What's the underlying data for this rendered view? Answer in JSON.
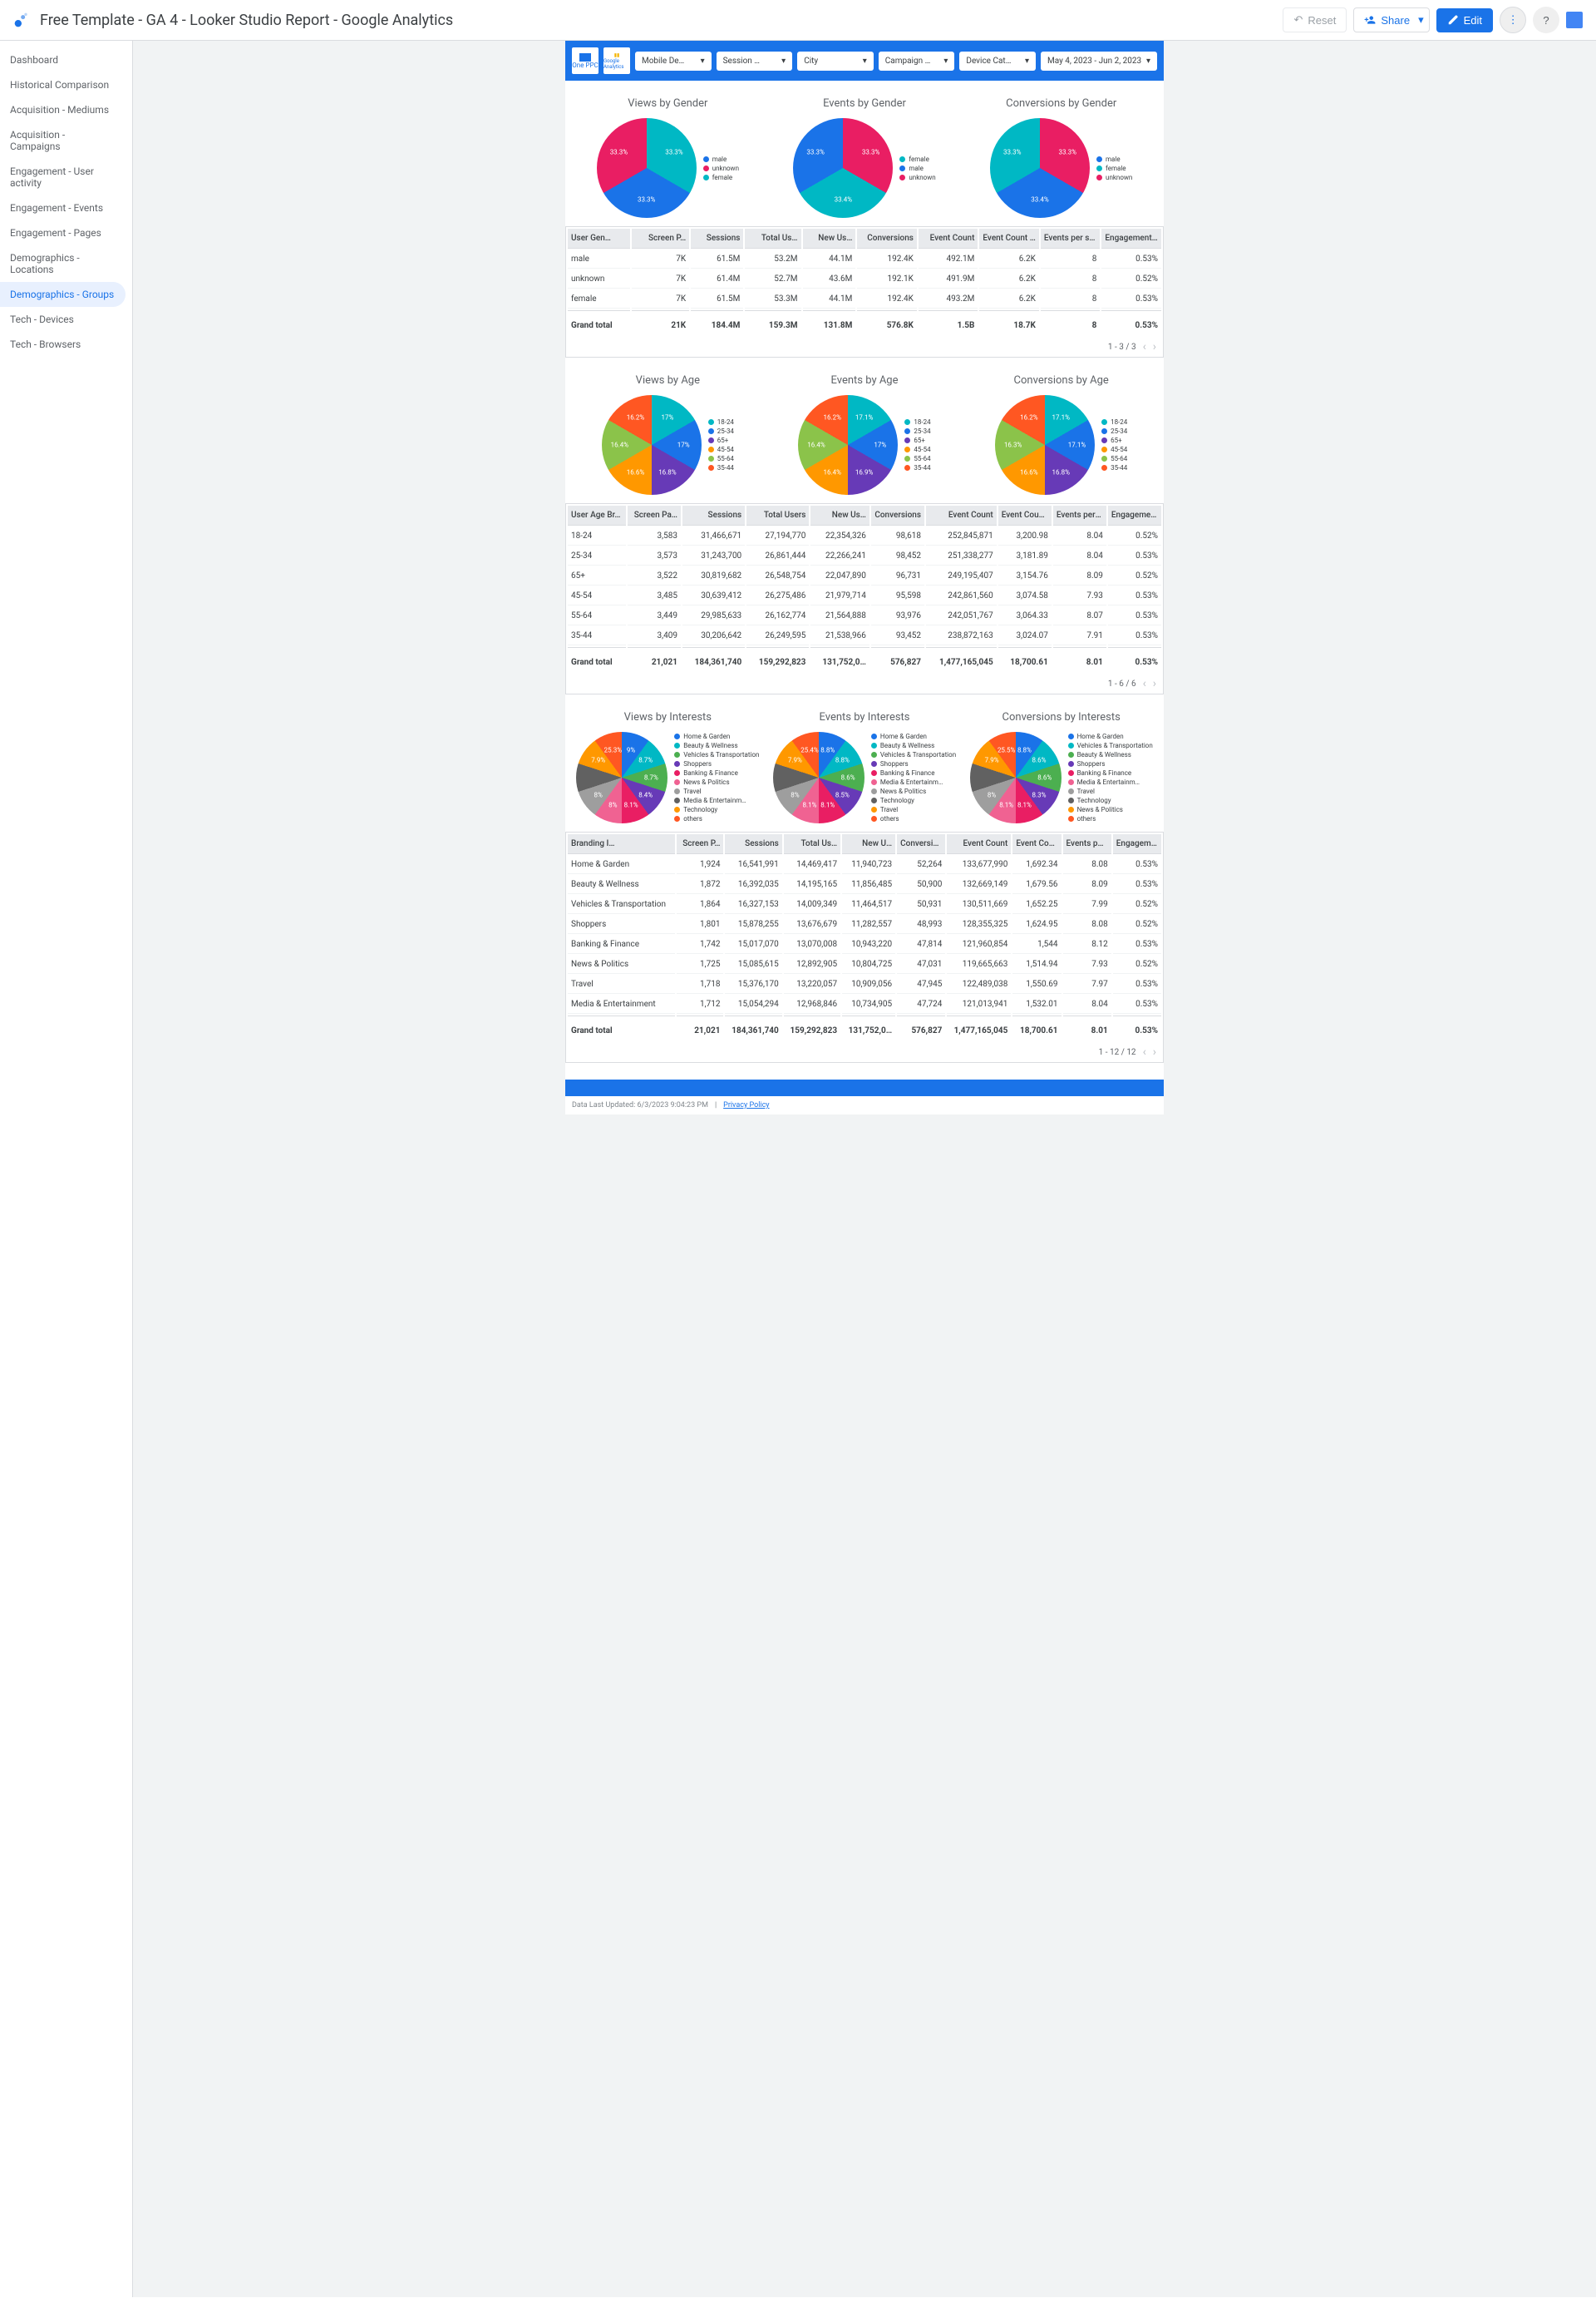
{
  "header": {
    "title": "Free Template - GA 4 - Looker Studio Report - Google Analytics",
    "reset": "Reset",
    "share": "Share",
    "edit": "Edit"
  },
  "sidebar": {
    "items": [
      "Dashboard",
      "Historical Comparison",
      "Acquisition - Mediums",
      "Acquisition - Campaigns",
      "Engagement - User activity",
      "Engagement - Events",
      "Engagement - Pages",
      "Demographics - Locations",
      "Demographics - Groups",
      "Tech - Devices",
      "Tech - Browsers"
    ],
    "activeIndex": 8
  },
  "filters": {
    "logos": [
      "One PPC",
      "Google Analytics"
    ],
    "items": [
      "Mobile De…",
      "Session …",
      "City",
      "Campaign …",
      "Device Cat…"
    ],
    "date": "May 4, 2023 - Jun 2, 2023"
  },
  "colors": {
    "teal": "#00b8c4",
    "blue": "#1a73e8",
    "magenta": "#e91e63",
    "purple": "#673ab7",
    "orange": "#ff9800",
    "green": "#4caf50",
    "lime": "#8bc34a",
    "deeporange": "#ff5722",
    "grey": "#9e9e9e",
    "darkgrey": "#616161",
    "pink": "#f06292"
  },
  "genderCharts": {
    "views": {
      "title": "Views by Gender",
      "slices": [
        {
          "label": "33.3%",
          "color": "teal"
        },
        {
          "label": "33.3%",
          "color": "blue"
        },
        {
          "label": "33.3%",
          "color": "magenta"
        }
      ],
      "legend": [
        {
          "c": "blue",
          "t": "male"
        },
        {
          "c": "magenta",
          "t": "unknown"
        },
        {
          "c": "teal",
          "t": "female"
        }
      ]
    },
    "events": {
      "title": "Events by Gender",
      "slices": [
        {
          "label": "33.3%",
          "color": "magenta"
        },
        {
          "label": "33.4%",
          "color": "teal"
        },
        {
          "label": "33.3%",
          "color": "blue"
        }
      ],
      "legend": [
        {
          "c": "teal",
          "t": "female"
        },
        {
          "c": "blue",
          "t": "male"
        },
        {
          "c": "magenta",
          "t": "unknown"
        }
      ]
    },
    "conversions": {
      "title": "Conversions by Gender",
      "slices": [
        {
          "label": "33.3%",
          "color": "magenta"
        },
        {
          "label": "33.4%",
          "color": "blue"
        },
        {
          "label": "33.3%",
          "color": "teal"
        }
      ],
      "legend": [
        {
          "c": "blue",
          "t": "male"
        },
        {
          "c": "teal",
          "t": "female"
        },
        {
          "c": "magenta",
          "t": "unknown"
        }
      ]
    }
  },
  "genderTable": {
    "headers": [
      "User Gen…",
      "Screen P…",
      "Sessions",
      "Total Us…",
      "New Us…",
      "Conversions",
      "Event Count",
      "Event Count Per U…",
      "Events per session",
      "Engagement …"
    ],
    "rows": [
      [
        "male",
        "7K",
        "61.5M",
        "53.2M",
        "44.1M",
        "192.4K",
        "492.1M",
        "6.2K",
        "8",
        "0.53%"
      ],
      [
        "unknown",
        "7K",
        "61.4M",
        "52.7M",
        "43.6M",
        "192.1K",
        "491.9M",
        "6.2K",
        "8",
        "0.52%"
      ],
      [
        "female",
        "7K",
        "61.5M",
        "53.3M",
        "44.1M",
        "192.4K",
        "493.2M",
        "6.2K",
        "8",
        "0.53%"
      ]
    ],
    "total": [
      "Grand total",
      "21K",
      "184.4M",
      "159.3M",
      "131.8M",
      "576.8K",
      "1.5B",
      "18.7K",
      "8",
      "0.53%"
    ],
    "pager": "1 - 3 / 3"
  },
  "ageCharts": {
    "titles": [
      "Views by Age",
      "Events by Age",
      "Conversions by Age"
    ],
    "legend": [
      {
        "c": "teal",
        "t": "18-24"
      },
      {
        "c": "blue",
        "t": "25-34"
      },
      {
        "c": "purple",
        "t": "65+"
      },
      {
        "c": "orange",
        "t": "45-54"
      },
      {
        "c": "lime",
        "t": "55-64"
      },
      {
        "c": "deeporange",
        "t": "35-44"
      }
    ],
    "variant0": [
      {
        "l": "17%",
        "c": "teal"
      },
      {
        "l": "17%",
        "c": "blue"
      },
      {
        "l": "16.8%",
        "c": "purple"
      },
      {
        "l": "16.6%",
        "c": "orange"
      },
      {
        "l": "16.4%",
        "c": "lime"
      },
      {
        "l": "16.2%",
        "c": "deeporange"
      }
    ],
    "variant1": [
      {
        "l": "17.1%",
        "c": "teal"
      },
      {
        "l": "17%",
        "c": "blue"
      },
      {
        "l": "16.9%",
        "c": "purple"
      },
      {
        "l": "16.4%",
        "c": "orange"
      },
      {
        "l": "16.4%",
        "c": "lime"
      },
      {
        "l": "16.2%",
        "c": "deeporange"
      }
    ],
    "variant2": [
      {
        "l": "17.1%",
        "c": "teal"
      },
      {
        "l": "17.1%",
        "c": "blue"
      },
      {
        "l": "16.8%",
        "c": "purple"
      },
      {
        "l": "16.6%",
        "c": "orange"
      },
      {
        "l": "16.3%",
        "c": "lime"
      },
      {
        "l": "16.2%",
        "c": "deeporange"
      }
    ]
  },
  "ageTable": {
    "headers": [
      "User Age Br…",
      "Screen Pa…",
      "Sessions",
      "Total Users",
      "New Us…",
      "Conversions",
      "Event Count",
      "Event Count Per User",
      "Events per session",
      "Engagement R…"
    ],
    "rows": [
      [
        "18-24",
        "3,583",
        "31,466,671",
        "27,194,770",
        "22,354,326",
        "98,618",
        "252,845,871",
        "3,200.98",
        "8.04",
        "0.52%"
      ],
      [
        "25-34",
        "3,573",
        "31,243,700",
        "26,861,444",
        "22,266,241",
        "98,452",
        "251,338,277",
        "3,181.89",
        "8.04",
        "0.53%"
      ],
      [
        "65+",
        "3,522",
        "30,819,682",
        "26,548,754",
        "22,047,890",
        "96,731",
        "249,195,407",
        "3,154.76",
        "8.09",
        "0.52%"
      ],
      [
        "45-54",
        "3,485",
        "30,639,412",
        "26,275,486",
        "21,979,714",
        "95,598",
        "242,861,560",
        "3,074.58",
        "7.93",
        "0.53%"
      ],
      [
        "55-64",
        "3,449",
        "29,985,633",
        "26,162,774",
        "21,564,888",
        "93,976",
        "242,051,767",
        "3,064.33",
        "8.07",
        "0.53%"
      ],
      [
        "35-44",
        "3,409",
        "30,206,642",
        "26,249,595",
        "21,538,966",
        "93,452",
        "238,872,163",
        "3,024.07",
        "7.91",
        "0.53%"
      ]
    ],
    "total": [
      "Grand total",
      "21,021",
      "184,361,740",
      "159,292,823",
      "131,752,0…",
      "576,827",
      "1,477,165,045",
      "18,700.61",
      "8.01",
      "0.53%"
    ],
    "pager": "1 - 6 / 6"
  },
  "interestCharts": {
    "titles": [
      "Views by Interests",
      "Events by Interests",
      "Conversions by Interests"
    ],
    "legends": [
      [
        {
          "c": "blue",
          "t": "Home & Garden"
        },
        {
          "c": "teal",
          "t": "Beauty & Wellness"
        },
        {
          "c": "green",
          "t": "Vehicles & Transportation"
        },
        {
          "c": "purple",
          "t": "Shoppers"
        },
        {
          "c": "magenta",
          "t": "Banking & Finance"
        },
        {
          "c": "pink",
          "t": "News & Politics"
        },
        {
          "c": "grey",
          "t": "Travel"
        },
        {
          "c": "darkgrey",
          "t": "Media & Entertainm…"
        },
        {
          "c": "orange",
          "t": "Technology"
        },
        {
          "c": "deeporange",
          "t": "others"
        }
      ],
      [
        {
          "c": "blue",
          "t": "Home & Garden"
        },
        {
          "c": "teal",
          "t": "Beauty & Wellness"
        },
        {
          "c": "green",
          "t": "Vehicles & Transportation"
        },
        {
          "c": "purple",
          "t": "Shoppers"
        },
        {
          "c": "magenta",
          "t": "Banking & Finance"
        },
        {
          "c": "pink",
          "t": "Media & Entertainm…"
        },
        {
          "c": "grey",
          "t": "News & Politics"
        },
        {
          "c": "darkgrey",
          "t": "Technology"
        },
        {
          "c": "orange",
          "t": "Travel"
        },
        {
          "c": "deeporange",
          "t": "others"
        }
      ],
      [
        {
          "c": "blue",
          "t": "Home & Garden"
        },
        {
          "c": "teal",
          "t": "Vehicles & Transportation"
        },
        {
          "c": "green",
          "t": "Beauty & Wellness"
        },
        {
          "c": "purple",
          "t": "Shoppers"
        },
        {
          "c": "magenta",
          "t": "Banking & Finance"
        },
        {
          "c": "pink",
          "t": "Media & Entertainm…"
        },
        {
          "c": "grey",
          "t": "Travel"
        },
        {
          "c": "darkgrey",
          "t": "Technology"
        },
        {
          "c": "orange",
          "t": "News & Politics"
        },
        {
          "c": "deeporange",
          "t": "others"
        }
      ]
    ],
    "slices": [
      [
        {
          "l": "9%",
          "c": "blue"
        },
        {
          "l": "8.7%",
          "c": "teal"
        },
        {
          "l": "8.7%",
          "c": "green"
        },
        {
          "l": "8.4%",
          "c": "purple"
        },
        {
          "l": "8.1%",
          "c": "magenta"
        },
        {
          "l": "8%",
          "c": "pink"
        },
        {
          "l": "8%",
          "c": "grey"
        },
        {
          "l": "",
          "c": "darkgrey"
        },
        {
          "l": "7.9%",
          "c": "orange"
        },
        {
          "l": "25.3%",
          "c": "deeporange"
        }
      ],
      [
        {
          "l": "8.8%",
          "c": "blue"
        },
        {
          "l": "8.8%",
          "c": "teal"
        },
        {
          "l": "8.6%",
          "c": "green"
        },
        {
          "l": "8.5%",
          "c": "purple"
        },
        {
          "l": "8.1%",
          "c": "magenta"
        },
        {
          "l": "8.1%",
          "c": "pink"
        },
        {
          "l": "8%",
          "c": "grey"
        },
        {
          "l": "",
          "c": "darkgrey"
        },
        {
          "l": "7.9%",
          "c": "orange"
        },
        {
          "l": "25.4%",
          "c": "deeporange"
        }
      ],
      [
        {
          "l": "8.8%",
          "c": "blue"
        },
        {
          "l": "8.6%",
          "c": "teal"
        },
        {
          "l": "8.6%",
          "c": "green"
        },
        {
          "l": "8.3%",
          "c": "purple"
        },
        {
          "l": "8.1%",
          "c": "magenta"
        },
        {
          "l": "8.1%",
          "c": "pink"
        },
        {
          "l": "8%",
          "c": "grey"
        },
        {
          "l": "",
          "c": "darkgrey"
        },
        {
          "l": "7.9%",
          "c": "orange"
        },
        {
          "l": "25.5%",
          "c": "deeporange"
        }
      ]
    ]
  },
  "interestTable": {
    "headers": [
      "Branding I…",
      "Screen P…",
      "Sessions",
      "Total Us…",
      "New U…",
      "Conversions",
      "Event Count",
      "Event Count Per U…",
      "Events per session",
      "Engagement …"
    ],
    "rows": [
      [
        "Home & Garden",
        "1,924",
        "16,541,991",
        "14,469,417",
        "11,940,723",
        "52,264",
        "133,677,990",
        "1,692.34",
        "8.08",
        "0.53%"
      ],
      [
        "Beauty & Wellness",
        "1,872",
        "16,392,035",
        "14,195,165",
        "11,856,485",
        "50,900",
        "132,669,149",
        "1,679.56",
        "8.09",
        "0.53%"
      ],
      [
        "Vehicles & Transportation",
        "1,864",
        "16,327,153",
        "14,009,349",
        "11,464,517",
        "50,931",
        "130,511,669",
        "1,652.25",
        "7.99",
        "0.52%"
      ],
      [
        "Shoppers",
        "1,801",
        "15,878,255",
        "13,676,679",
        "11,282,557",
        "48,993",
        "128,355,325",
        "1,624.95",
        "8.08",
        "0.52%"
      ],
      [
        "Banking & Finance",
        "1,742",
        "15,017,070",
        "13,070,008",
        "10,943,220",
        "47,814",
        "121,960,854",
        "1,544",
        "8.12",
        "0.53%"
      ],
      [
        "News & Politics",
        "1,725",
        "15,085,615",
        "12,892,905",
        "10,804,725",
        "47,031",
        "119,665,663",
        "1,514.94",
        "7.93",
        "0.52%"
      ],
      [
        "Travel",
        "1,718",
        "15,376,170",
        "13,220,057",
        "10,909,056",
        "47,945",
        "122,489,038",
        "1,550.69",
        "7.97",
        "0.53%"
      ],
      [
        "Media & Entertainment",
        "1,712",
        "15,054,294",
        "12,968,846",
        "10,734,905",
        "47,724",
        "121,013,941",
        "1,532.01",
        "8.04",
        "0.53%"
      ]
    ],
    "total": [
      "Grand total",
      "21,021",
      "184,361,740",
      "159,292,823",
      "131,752,0…",
      "576,827",
      "1,477,165,045",
      "18,700.61",
      "8.01",
      "0.53%"
    ],
    "pager": "1 - 12 / 12"
  },
  "footer": {
    "updated": "Data Last Updated: 6/3/2023 9:04:23 PM",
    "privacy": "Privacy Policy"
  },
  "chart_data": [
    {
      "type": "pie",
      "title": "Views by Gender",
      "series": [
        {
          "name": "male",
          "value": 33.3
        },
        {
          "name": "unknown",
          "value": 33.3
        },
        {
          "name": "female",
          "value": 33.3
        }
      ]
    },
    {
      "type": "pie",
      "title": "Events by Gender",
      "series": [
        {
          "name": "female",
          "value": 33.4
        },
        {
          "name": "male",
          "value": 33.3
        },
        {
          "name": "unknown",
          "value": 33.3
        }
      ]
    },
    {
      "type": "pie",
      "title": "Conversions by Gender",
      "series": [
        {
          "name": "male",
          "value": 33.4
        },
        {
          "name": "female",
          "value": 33.3
        },
        {
          "name": "unknown",
          "value": 33.3
        }
      ]
    },
    {
      "type": "pie",
      "title": "Views by Age",
      "series": [
        {
          "name": "18-24",
          "value": 17.0
        },
        {
          "name": "25-34",
          "value": 17.0
        },
        {
          "name": "65+",
          "value": 16.8
        },
        {
          "name": "45-54",
          "value": 16.6
        },
        {
          "name": "55-64",
          "value": 16.4
        },
        {
          "name": "35-44",
          "value": 16.2
        }
      ]
    },
    {
      "type": "pie",
      "title": "Events by Age",
      "series": [
        {
          "name": "18-24",
          "value": 17.1
        },
        {
          "name": "25-34",
          "value": 17.0
        },
        {
          "name": "65+",
          "value": 16.9
        },
        {
          "name": "45-54",
          "value": 16.4
        },
        {
          "name": "55-64",
          "value": 16.4
        },
        {
          "name": "35-44",
          "value": 16.2
        }
      ]
    },
    {
      "type": "pie",
      "title": "Conversions by Age",
      "series": [
        {
          "name": "18-24",
          "value": 17.1
        },
        {
          "name": "25-34",
          "value": 17.1
        },
        {
          "name": "65+",
          "value": 16.8
        },
        {
          "name": "45-54",
          "value": 16.6
        },
        {
          "name": "55-64",
          "value": 16.3
        },
        {
          "name": "35-44",
          "value": 16.2
        }
      ]
    },
    {
      "type": "pie",
      "title": "Views by Interests",
      "series": [
        {
          "name": "Home & Garden",
          "value": 9.0
        },
        {
          "name": "Beauty & Wellness",
          "value": 8.7
        },
        {
          "name": "Vehicles & Transportation",
          "value": 8.7
        },
        {
          "name": "Shoppers",
          "value": 8.4
        },
        {
          "name": "Banking & Finance",
          "value": 8.1
        },
        {
          "name": "News & Politics",
          "value": 8.0
        },
        {
          "name": "Travel",
          "value": 8.0
        },
        {
          "name": "Media & Entertainment",
          "value": 8.0
        },
        {
          "name": "Technology",
          "value": 7.9
        },
        {
          "name": "others",
          "value": 25.3
        }
      ]
    },
    {
      "type": "pie",
      "title": "Events by Interests",
      "series": [
        {
          "name": "Home & Garden",
          "value": 8.8
        },
        {
          "name": "Beauty & Wellness",
          "value": 8.8
        },
        {
          "name": "Vehicles & Transportation",
          "value": 8.6
        },
        {
          "name": "Shoppers",
          "value": 8.5
        },
        {
          "name": "Banking & Finance",
          "value": 8.1
        },
        {
          "name": "Media & Entertainment",
          "value": 8.1
        },
        {
          "name": "News & Politics",
          "value": 8.0
        },
        {
          "name": "Technology",
          "value": 8.0
        },
        {
          "name": "Travel",
          "value": 7.9
        },
        {
          "name": "others",
          "value": 25.4
        }
      ]
    },
    {
      "type": "pie",
      "title": "Conversions by Interests",
      "series": [
        {
          "name": "Home & Garden",
          "value": 8.8
        },
        {
          "name": "Vehicles & Transportation",
          "value": 8.6
        },
        {
          "name": "Beauty & Wellness",
          "value": 8.6
        },
        {
          "name": "Shoppers",
          "value": 8.3
        },
        {
          "name": "Banking & Finance",
          "value": 8.1
        },
        {
          "name": "Media & Entertainment",
          "value": 8.1
        },
        {
          "name": "Travel",
          "value": 8.0
        },
        {
          "name": "Technology",
          "value": 8.0
        },
        {
          "name": "News & Politics",
          "value": 7.9
        },
        {
          "name": "others",
          "value": 25.5
        }
      ]
    }
  ]
}
